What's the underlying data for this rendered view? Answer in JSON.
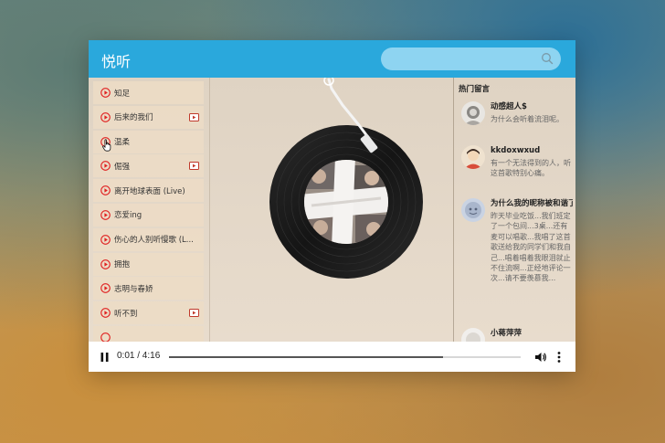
{
  "app": {
    "title": "悦听"
  },
  "search": {
    "placeholder": ""
  },
  "songs": [
    {
      "title": "知足",
      "mv": false
    },
    {
      "title": "后来的我们",
      "mv": true
    },
    {
      "title": "温柔",
      "mv": false
    },
    {
      "title": "倔强",
      "mv": true
    },
    {
      "title": "离开地球表面 (Live)",
      "mv": false
    },
    {
      "title": "恋爱ing",
      "mv": false
    },
    {
      "title": "伤心的人别听慢歌 (L...",
      "mv": false
    },
    {
      "title": "拥抱",
      "mv": false
    },
    {
      "title": "志明与春娇",
      "mv": false
    },
    {
      "title": "听不到",
      "mv": true
    }
  ],
  "comments": {
    "title": "热门留言",
    "items": [
      {
        "name": "动感超人$",
        "text": "为什么会听着流泪呢。"
      },
      {
        "name": "kkdoxwxud",
        "text": "有一个无法得到的人，听这首歌特别心痛。"
      },
      {
        "name": "为什么我的昵称被和谐了",
        "text": "昨天毕业吃饭...我们班定了一个包间...3桌...还有麦可以唱歌...我唱了这首歌送给我的同学们和我自己...唱着唱着我眼泪就止不住流啊...正经地评论一次...请不要羡慕我..."
      },
      {
        "name": "小蒋萍萍",
        "text": ""
      }
    ]
  },
  "player": {
    "time": "0:01 / 4:16",
    "progress": 0.78
  },
  "colors": {
    "header": "#2aa8dc",
    "search": "#8ed4f1",
    "play_icon": "#e02020",
    "mv_icon": "#c0392b"
  },
  "icons": {
    "play": "play-circle-icon",
    "mv": "mv-icon",
    "search": "search-icon",
    "pause": "pause-icon",
    "volume": "volume-icon",
    "more": "more-vertical-icon"
  }
}
